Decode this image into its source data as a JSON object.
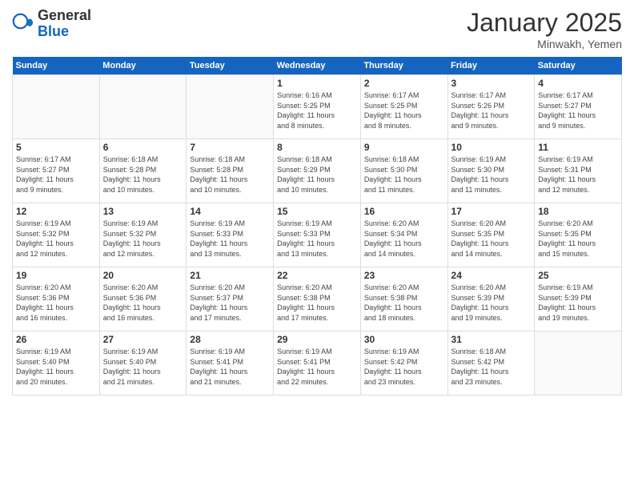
{
  "logo": {
    "general": "General",
    "blue": "Blue"
  },
  "header": {
    "month": "January 2025",
    "location": "Minwakh, Yemen"
  },
  "weekdays": [
    "Sunday",
    "Monday",
    "Tuesday",
    "Wednesday",
    "Thursday",
    "Friday",
    "Saturday"
  ],
  "weeks": [
    [
      {
        "day": "",
        "info": ""
      },
      {
        "day": "",
        "info": ""
      },
      {
        "day": "",
        "info": ""
      },
      {
        "day": "1",
        "info": "Sunrise: 6:16 AM\nSunset: 5:25 PM\nDaylight: 11 hours\nand 8 minutes."
      },
      {
        "day": "2",
        "info": "Sunrise: 6:17 AM\nSunset: 5:25 PM\nDaylight: 11 hours\nand 8 minutes."
      },
      {
        "day": "3",
        "info": "Sunrise: 6:17 AM\nSunset: 5:26 PM\nDaylight: 11 hours\nand 9 minutes."
      },
      {
        "day": "4",
        "info": "Sunrise: 6:17 AM\nSunset: 5:27 PM\nDaylight: 11 hours\nand 9 minutes."
      }
    ],
    [
      {
        "day": "5",
        "info": "Sunrise: 6:17 AM\nSunset: 5:27 PM\nDaylight: 11 hours\nand 9 minutes."
      },
      {
        "day": "6",
        "info": "Sunrise: 6:18 AM\nSunset: 5:28 PM\nDaylight: 11 hours\nand 10 minutes."
      },
      {
        "day": "7",
        "info": "Sunrise: 6:18 AM\nSunset: 5:28 PM\nDaylight: 11 hours\nand 10 minutes."
      },
      {
        "day": "8",
        "info": "Sunrise: 6:18 AM\nSunset: 5:29 PM\nDaylight: 11 hours\nand 10 minutes."
      },
      {
        "day": "9",
        "info": "Sunrise: 6:18 AM\nSunset: 5:30 PM\nDaylight: 11 hours\nand 11 minutes."
      },
      {
        "day": "10",
        "info": "Sunrise: 6:19 AM\nSunset: 5:30 PM\nDaylight: 11 hours\nand 11 minutes."
      },
      {
        "day": "11",
        "info": "Sunrise: 6:19 AM\nSunset: 5:31 PM\nDaylight: 11 hours\nand 12 minutes."
      }
    ],
    [
      {
        "day": "12",
        "info": "Sunrise: 6:19 AM\nSunset: 5:32 PM\nDaylight: 11 hours\nand 12 minutes."
      },
      {
        "day": "13",
        "info": "Sunrise: 6:19 AM\nSunset: 5:32 PM\nDaylight: 11 hours\nand 12 minutes."
      },
      {
        "day": "14",
        "info": "Sunrise: 6:19 AM\nSunset: 5:33 PM\nDaylight: 11 hours\nand 13 minutes."
      },
      {
        "day": "15",
        "info": "Sunrise: 6:19 AM\nSunset: 5:33 PM\nDaylight: 11 hours\nand 13 minutes."
      },
      {
        "day": "16",
        "info": "Sunrise: 6:20 AM\nSunset: 5:34 PM\nDaylight: 11 hours\nand 14 minutes."
      },
      {
        "day": "17",
        "info": "Sunrise: 6:20 AM\nSunset: 5:35 PM\nDaylight: 11 hours\nand 14 minutes."
      },
      {
        "day": "18",
        "info": "Sunrise: 6:20 AM\nSunset: 5:35 PM\nDaylight: 11 hours\nand 15 minutes."
      }
    ],
    [
      {
        "day": "19",
        "info": "Sunrise: 6:20 AM\nSunset: 5:36 PM\nDaylight: 11 hours\nand 16 minutes."
      },
      {
        "day": "20",
        "info": "Sunrise: 6:20 AM\nSunset: 5:36 PM\nDaylight: 11 hours\nand 16 minutes."
      },
      {
        "day": "21",
        "info": "Sunrise: 6:20 AM\nSunset: 5:37 PM\nDaylight: 11 hours\nand 17 minutes."
      },
      {
        "day": "22",
        "info": "Sunrise: 6:20 AM\nSunset: 5:38 PM\nDaylight: 11 hours\nand 17 minutes."
      },
      {
        "day": "23",
        "info": "Sunrise: 6:20 AM\nSunset: 5:38 PM\nDaylight: 11 hours\nand 18 minutes."
      },
      {
        "day": "24",
        "info": "Sunrise: 6:20 AM\nSunset: 5:39 PM\nDaylight: 11 hours\nand 19 minutes."
      },
      {
        "day": "25",
        "info": "Sunrise: 6:19 AM\nSunset: 5:39 PM\nDaylight: 11 hours\nand 19 minutes."
      }
    ],
    [
      {
        "day": "26",
        "info": "Sunrise: 6:19 AM\nSunset: 5:40 PM\nDaylight: 11 hours\nand 20 minutes."
      },
      {
        "day": "27",
        "info": "Sunrise: 6:19 AM\nSunset: 5:40 PM\nDaylight: 11 hours\nand 21 minutes."
      },
      {
        "day": "28",
        "info": "Sunrise: 6:19 AM\nSunset: 5:41 PM\nDaylight: 11 hours\nand 21 minutes."
      },
      {
        "day": "29",
        "info": "Sunrise: 6:19 AM\nSunset: 5:41 PM\nDaylight: 11 hours\nand 22 minutes."
      },
      {
        "day": "30",
        "info": "Sunrise: 6:19 AM\nSunset: 5:42 PM\nDaylight: 11 hours\nand 23 minutes."
      },
      {
        "day": "31",
        "info": "Sunrise: 6:18 AM\nSunset: 5:42 PM\nDaylight: 11 hours\nand 23 minutes."
      },
      {
        "day": "",
        "info": ""
      }
    ]
  ]
}
